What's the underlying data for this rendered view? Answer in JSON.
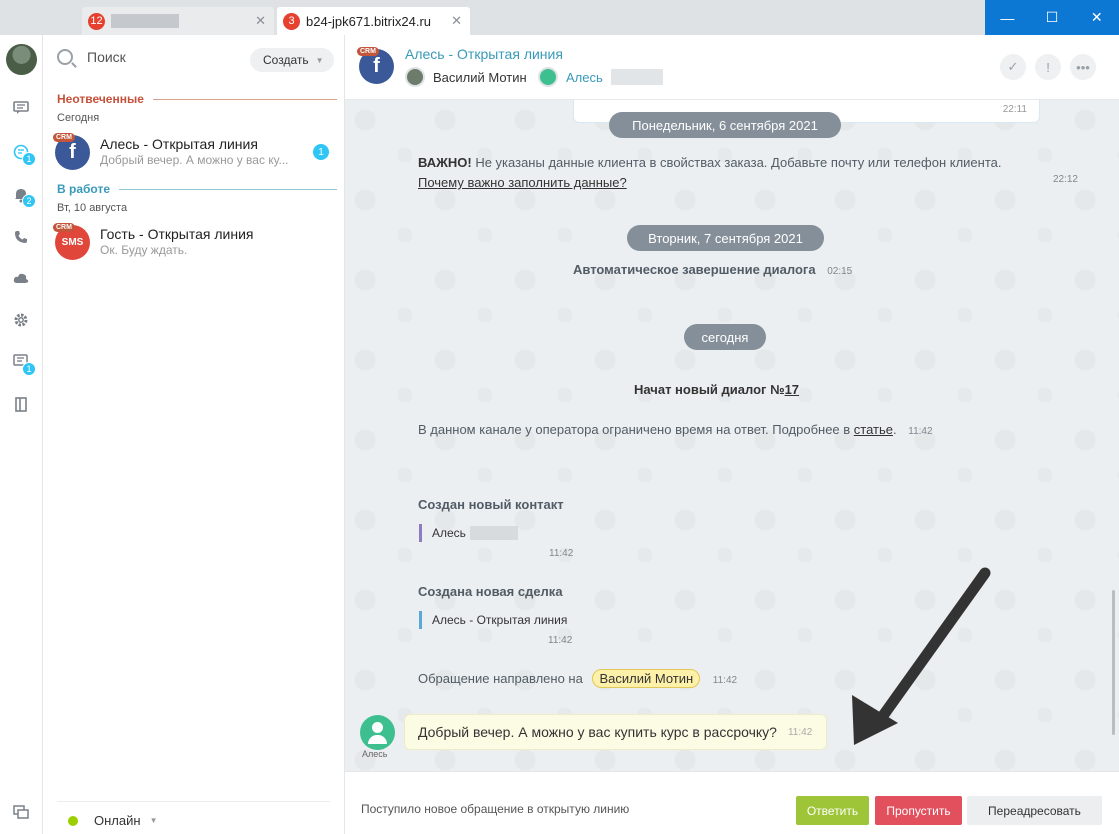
{
  "tabs": [
    {
      "count": "12",
      "title": ""
    },
    {
      "count": "3",
      "title": "b24-jpk671.bitrix24.ru"
    }
  ],
  "window_controls": {
    "minimize": "—",
    "maximize": "☐",
    "close": "✕"
  },
  "rail": {
    "badges": {
      "chats": "1",
      "notifications": "2",
      "lines": "1"
    }
  },
  "list": {
    "search_placeholder": "Поиск",
    "create_label": "Создать",
    "section_unanswered": "Неотвеченные",
    "today_label": "Сегодня",
    "section_inwork": "В работе",
    "date_label": "Вт, 10 августа",
    "items": [
      {
        "crm": "CRM",
        "name": "Алесь - Открытая линия",
        "last": "Добрый вечер. А можно у вас ку...",
        "badge": "1"
      },
      {
        "crm": "CRM",
        "name": "Гость - Открытая линия",
        "last": "Ок. Буду ждать.",
        "icon_text": "SMS"
      }
    ],
    "status": "Онлайн"
  },
  "header": {
    "crm": "CRM",
    "title": "Алесь - Открытая линия",
    "operator": "Василий Мотин",
    "client": "Алесь"
  },
  "messages": {
    "prev_time": "22:11",
    "date1": "Понедельник, 6 сентября 2021",
    "warning_bold": "ВАЖНО!",
    "warning_text": " Не указаны данные клиента в свойствах заказа. Добавьте почту или телефон клиента. ",
    "warning_link": "Почему важно заполнить данные?",
    "warning_time": "22:12",
    "date2": "Вторник, 7 сентября 2021",
    "auto_close": "Автоматическое завершение диалога",
    "auto_close_time": "02:15",
    "date3": "сегодня",
    "new_dialog_prefix": "Начат новый диалог №",
    "new_dialog_num": "17",
    "limit_text": "В данном канале у оператора ограничено время на ответ. Подробнее в ",
    "limit_link": "статье",
    "limit_dot": ".",
    "limit_time": "11:42",
    "new_contact_title": "Создан новый контакт",
    "new_contact_name": "Алесь",
    "new_contact_time": "11:42",
    "new_deal_title": "Создана новая сделка",
    "new_deal_name": "Алесь - Открытая линия",
    "new_deal_time": "11:42",
    "routed_text": "Обращение направлено на",
    "routed_to": "Василий Мотин",
    "routed_time": "11:42",
    "client_name": "Алесь",
    "client_message": "Добрый вечер. А можно у вас купить курс в рассрочку?",
    "client_time": "11:42"
  },
  "footer": {
    "note": "Поступило новое обращение в открытую линию",
    "answer": "Ответить",
    "skip": "Пропустить",
    "redirect": "Переадресовать"
  },
  "colors": {
    "accent_blue": "#0d78d3",
    "answer_green": "#9dc537",
    "skip_red": "#e24f5d",
    "badge_blue": "#2fc6f6"
  }
}
